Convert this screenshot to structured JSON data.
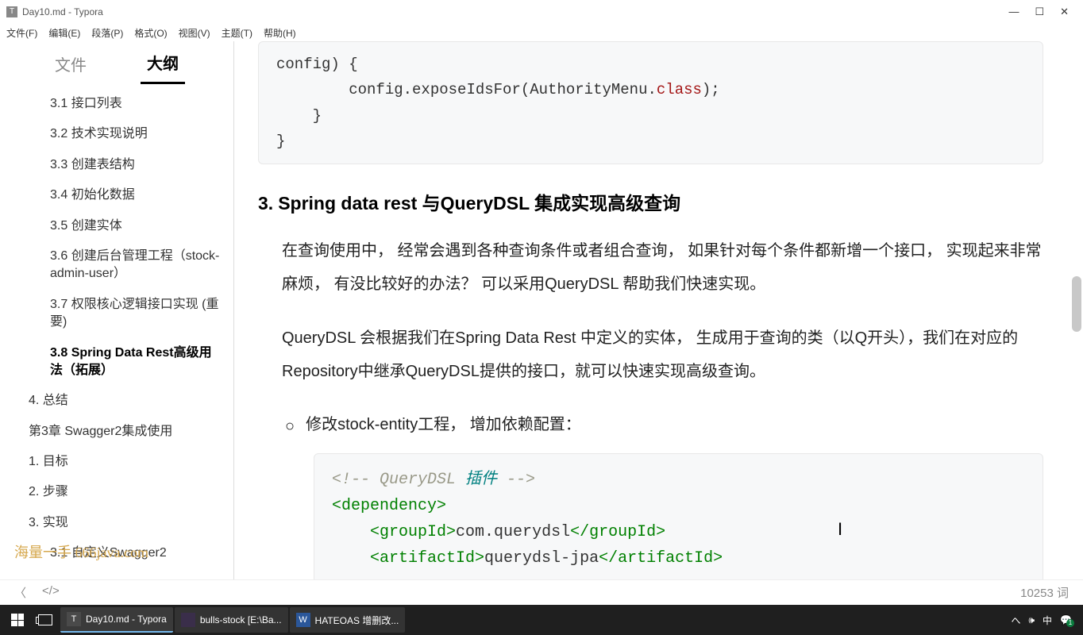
{
  "titlebar": {
    "icon_letter": "T",
    "title": "Day10.md - Typora"
  },
  "menubar": {
    "file": "文件(F)",
    "edit": "编辑(E)",
    "paragraph": "段落(P)",
    "format": "格式(O)",
    "view": "视图(V)",
    "theme": "主题(T)",
    "help": "帮助(H)"
  },
  "sidebar": {
    "tab_file": "文件",
    "tab_outline": "大纲",
    "items": [
      {
        "level": "l2",
        "label": "3.1 接口列表",
        "active": false,
        "key": "31"
      },
      {
        "level": "l2",
        "label": "3.2 技术实现说明",
        "active": false,
        "key": "32"
      },
      {
        "level": "l2",
        "label": "3.3 创建表结构",
        "active": false,
        "key": "33"
      },
      {
        "level": "l2",
        "label": "3.4 初始化数据",
        "active": false,
        "key": "34"
      },
      {
        "level": "l2",
        "label": "3.5 创建实体",
        "active": false,
        "key": "35"
      },
      {
        "level": "l2",
        "label": "3.6 创建后台管理工程（stock-admin-user）",
        "active": false,
        "key": "36"
      },
      {
        "level": "l2",
        "label": "3.7 权限核心逻辑接口实现 (重要)",
        "active": false,
        "key": "37"
      },
      {
        "level": "l2",
        "label": "3.8 Spring Data Rest高级用法（拓展）",
        "active": true,
        "key": "38"
      },
      {
        "level": "l1",
        "label": "4. 总结",
        "active": false,
        "key": "4"
      },
      {
        "level": "l1",
        "label": "第3章 Swagger2集成使用",
        "active": false,
        "key": "c3"
      },
      {
        "level": "l1",
        "label": "1. 目标",
        "active": false,
        "key": "s1"
      },
      {
        "level": "l1",
        "label": "2. 步骤",
        "active": false,
        "key": "s2"
      },
      {
        "level": "l1",
        "label": "3. 实现",
        "active": false,
        "key": "s3"
      },
      {
        "level": "l2",
        "label": "3.1 自定义Swagger2",
        "active": false,
        "key": "s31"
      }
    ]
  },
  "content": {
    "code1_line1": "config) {",
    "code1_line2": "        config.exposeIdsFor(AuthorityMenu.class);",
    "code1_line3": "    }",
    "code1_line4": "}",
    "heading_num": "3.",
    "heading_text": "Spring data rest 与QueryDSL 集成实现高级查询",
    "para1": "在查询使用中， 经常会遇到各种查询条件或者组合查询， 如果针对每个条件都新增一个接口， 实现起来非常麻烦， 有没比较好的办法？ 可以采用QueryDSL 帮助我们快速实现。",
    "para2": "QueryDSL 会根据我们在Spring Data Rest 中定义的实体， 生成用于查询的类（以Q开头），我们在对应的Repository中继承QueryDSL提供的接口，就可以快速实现高级查询。",
    "subitem1": "修改stock-entity工程， 增加依赖配置：",
    "xml": {
      "comment_open": "<!-- ",
      "comment_text": "QueryDSL",
      "comment_cn": " 插件 ",
      "comment_close": "-->",
      "dep_open": "<dependency>",
      "gid_open": "<groupId>",
      "gid_text": "com.querydsl",
      "gid_close": "</groupId>",
      "aid_open": "<artifactId>",
      "aid_text": "querydsl-jpa",
      "aid_close": "</artifactId>"
    }
  },
  "bottombar": {
    "back": "〈",
    "code": "</>",
    "wordcount": "10253 词"
  },
  "watermark": "海量一手 666java.com",
  "taskbar": {
    "typora": "Day10.md - Typora",
    "idea": "bulls-stock [E:\\Ba...",
    "word": "HATEOAS 增删改...",
    "tray_lang": "中"
  }
}
